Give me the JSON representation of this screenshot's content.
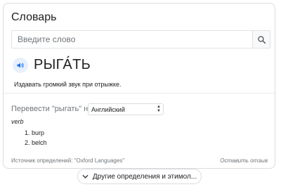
{
  "panel": {
    "title": "Словарь"
  },
  "search": {
    "placeholder": "Введите слово"
  },
  "entry": {
    "headword": "РЫГА́ТЬ",
    "definition": "Издавать громкий звук при отрыжке."
  },
  "translate": {
    "label": "Перевести \"рыгать\" на",
    "selected_language": "Английский",
    "part_of_speech": "verb",
    "senses": [
      "1. burp",
      "2. belch"
    ]
  },
  "footer": {
    "source": "Источник определений: \"Oxford Languages\"",
    "feedback": "Оставить отзыв"
  },
  "more": {
    "label": "Другие определения и этимол..."
  },
  "colors": {
    "accent": "#1a73e8",
    "border": "#dadce0",
    "muted_text": "#70757a"
  }
}
